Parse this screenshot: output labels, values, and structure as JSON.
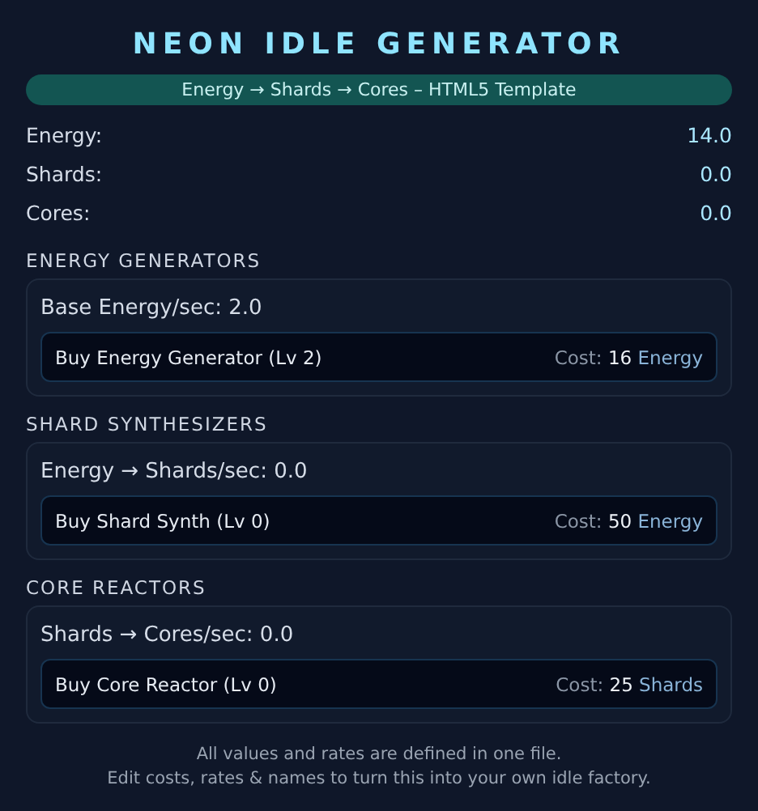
{
  "title": "NEON IDLE GENERATOR",
  "subtitle": "Energy → Shards → Cores – HTML5 Template",
  "resources": [
    {
      "label": "Energy:",
      "value": "14.0"
    },
    {
      "label": "Shards:",
      "value": "0.0"
    },
    {
      "label": "Cores:",
      "value": "0.0"
    }
  ],
  "sections": [
    {
      "heading": "ENERGY GENERATORS",
      "rate": "Base Energy/sec: 2.0",
      "button": "Buy Energy Generator (Lv 2)",
      "cost_label": "Cost:",
      "cost_amount": "16",
      "cost_unit": "Energy"
    },
    {
      "heading": "SHARD SYNTHESIZERS",
      "rate": "Energy → Shards/sec: 0.0",
      "button": "Buy Shard Synth (Lv 0)",
      "cost_label": "Cost:",
      "cost_amount": "50",
      "cost_unit": "Energy"
    },
    {
      "heading": "CORE REACTORS",
      "rate": "Shards → Cores/sec: 0.0",
      "button": "Buy Core Reactor (Lv 0)",
      "cost_label": "Cost:",
      "cost_amount": "25",
      "cost_unit": "Shards"
    }
  ],
  "footer": [
    "All values and rates are defined in one file.",
    "Edit costs, rates & names to turn this into your own idle factory."
  ]
}
